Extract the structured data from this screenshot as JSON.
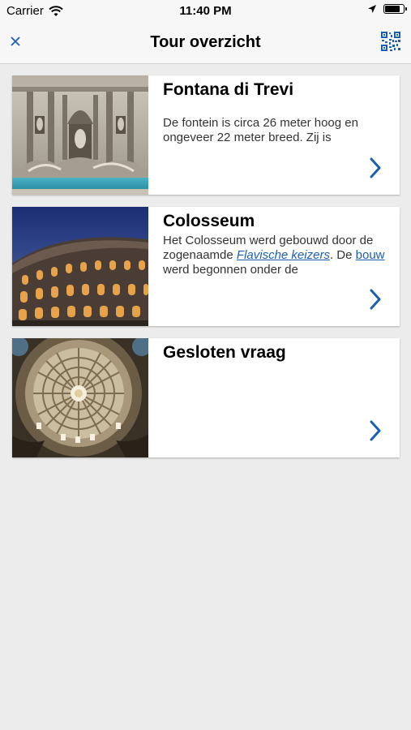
{
  "status": {
    "carrier": "Carrier",
    "time": "11:40 PM",
    "battery_level": 0.9
  },
  "nav": {
    "title": "Tour overzicht",
    "close_icon": "close-icon",
    "qr_icon": "qr-code-icon",
    "accent": "#1a5fb4"
  },
  "cards": [
    {
      "title": "Fontana di Trevi",
      "desc": "De fontein is circa 26 meter hoog en ongeveer 22 meter breed. Zij is"
    },
    {
      "title": "Colosseum",
      "desc_part1": "Het Colosseum werd gebouwd door de zogenaamde ",
      "desc_link1": "Flavische keizers",
      "desc_part2": ". De ",
      "desc_link2": "bouw",
      "desc_part3": " werd begonnen onder de"
    },
    {
      "title": "Gesloten vraag",
      "desc": ""
    }
  ]
}
